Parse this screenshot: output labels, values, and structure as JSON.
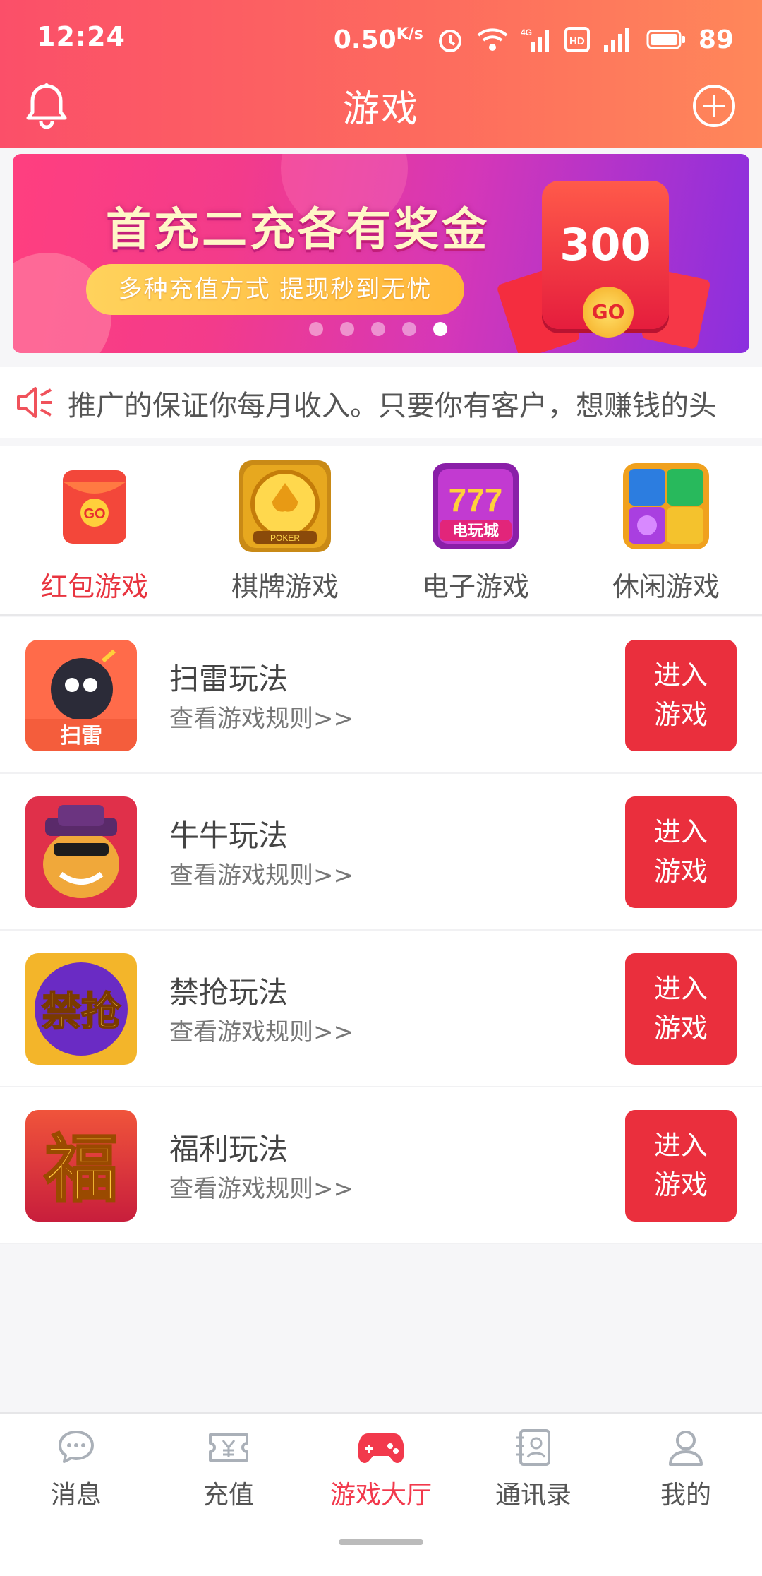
{
  "status": {
    "time": "12:24",
    "net_speed": "0.50",
    "net_unit": "K/s",
    "battery": "89"
  },
  "header": {
    "title": "游戏"
  },
  "banner": {
    "headline": "首充二充各有奖金",
    "subtitle": "多种充值方式 提现秒到无忧",
    "amount": "300",
    "go_label": "GO",
    "slide_count": 5,
    "active_slide": 5
  },
  "notice": {
    "text": "推广的保证你每月收入。只要你有客户，想赚钱的头"
  },
  "categories": [
    {
      "label": "红包游戏",
      "active": true,
      "icon": "red-envelope-icon",
      "icon_text": "GO"
    },
    {
      "label": "棋牌游戏",
      "active": false,
      "icon": "poker-chip-icon",
      "icon_text": "POKER"
    },
    {
      "label": "电子游戏",
      "active": false,
      "icon": "slot-777-icon",
      "icon_text": "电玩城"
    },
    {
      "label": "休闲游戏",
      "active": false,
      "icon": "gem-puzzle-icon"
    }
  ],
  "games": [
    {
      "name": "扫雷玩法",
      "rule": "查看游戏规则>>",
      "button": "进入游戏",
      "button_line1": "进入",
      "button_line2": "游戏",
      "thumb_text": "扫雷"
    },
    {
      "name": "牛牛玩法",
      "rule": "查看游戏规则>>",
      "button": "进入游戏",
      "button_line1": "进入",
      "button_line2": "游戏"
    },
    {
      "name": "禁抢玩法",
      "rule": "查看游戏规则>>",
      "button": "进入游戏",
      "button_line1": "进入",
      "button_line2": "游戏",
      "thumb_text": "禁抢"
    },
    {
      "name": "福利玩法",
      "rule": "查看游戏规则>>",
      "button": "进入游戏",
      "button_line1": "进入",
      "button_line2": "游戏",
      "thumb_text": "福"
    }
  ],
  "tabs": [
    {
      "label": "消息",
      "icon": "chat-bubble-icon",
      "active": false
    },
    {
      "label": "充值",
      "icon": "yen-ticket-icon",
      "active": false
    },
    {
      "label": "游戏大厅",
      "icon": "gamepad-icon",
      "active": true
    },
    {
      "label": "通讯录",
      "icon": "contacts-icon",
      "active": false
    },
    {
      "label": "我的",
      "icon": "user-icon",
      "active": false
    }
  ],
  "colors": {
    "accent": "#ea2f3d",
    "header_start": "#fb4f69",
    "header_end": "#ff875a",
    "active_tab": "#f2394c"
  }
}
